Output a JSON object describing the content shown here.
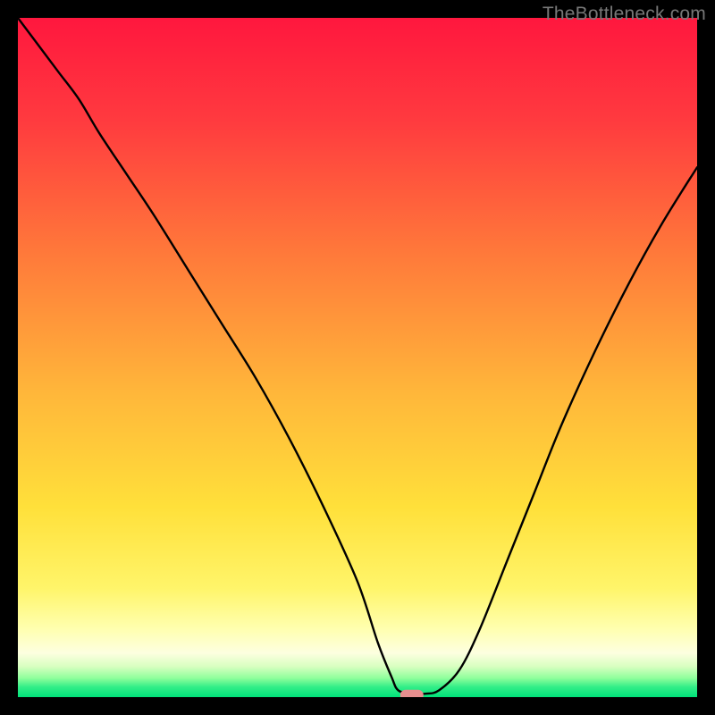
{
  "watermark": "TheBottleneck.com",
  "chart_data": {
    "type": "line",
    "title": "",
    "xlabel": "",
    "ylabel": "",
    "xlim": [
      0,
      100
    ],
    "ylim": [
      0,
      100
    ],
    "series": [
      {
        "name": "bottleneck-curve",
        "x": [
          0,
          3,
          6,
          9,
          12,
          16,
          20,
          25,
          30,
          35,
          40,
          45,
          50,
          53,
          55,
          56,
          58,
          60,
          62,
          65,
          68,
          72,
          76,
          80,
          85,
          90,
          95,
          100
        ],
        "y": [
          100,
          96,
          92,
          88,
          83,
          77,
          71,
          63,
          55,
          47,
          38,
          28,
          17,
          8,
          3,
          1,
          0.5,
          0.5,
          1,
          4,
          10,
          20,
          30,
          40,
          51,
          61,
          70,
          78
        ]
      }
    ],
    "marker": {
      "x": 58,
      "y": 0.3,
      "color": "#e78f8f"
    },
    "gradient_bands": {
      "description": "Vertical gradient background from red (top) through orange/yellow to pale yellow, with thin green band at bottom",
      "stops": [
        {
          "pos": 0.0,
          "color": "#ff173e"
        },
        {
          "pos": 0.15,
          "color": "#ff3a3f"
        },
        {
          "pos": 0.35,
          "color": "#ff7a3a"
        },
        {
          "pos": 0.55,
          "color": "#ffb63a"
        },
        {
          "pos": 0.72,
          "color": "#ffe03a"
        },
        {
          "pos": 0.84,
          "color": "#fff56a"
        },
        {
          "pos": 0.9,
          "color": "#ffffb0"
        },
        {
          "pos": 0.935,
          "color": "#fdffe0"
        },
        {
          "pos": 0.955,
          "color": "#d8ffc0"
        },
        {
          "pos": 0.972,
          "color": "#8fff9c"
        },
        {
          "pos": 0.985,
          "color": "#33ee88"
        },
        {
          "pos": 1.0,
          "color": "#00e37a"
        }
      ]
    }
  }
}
